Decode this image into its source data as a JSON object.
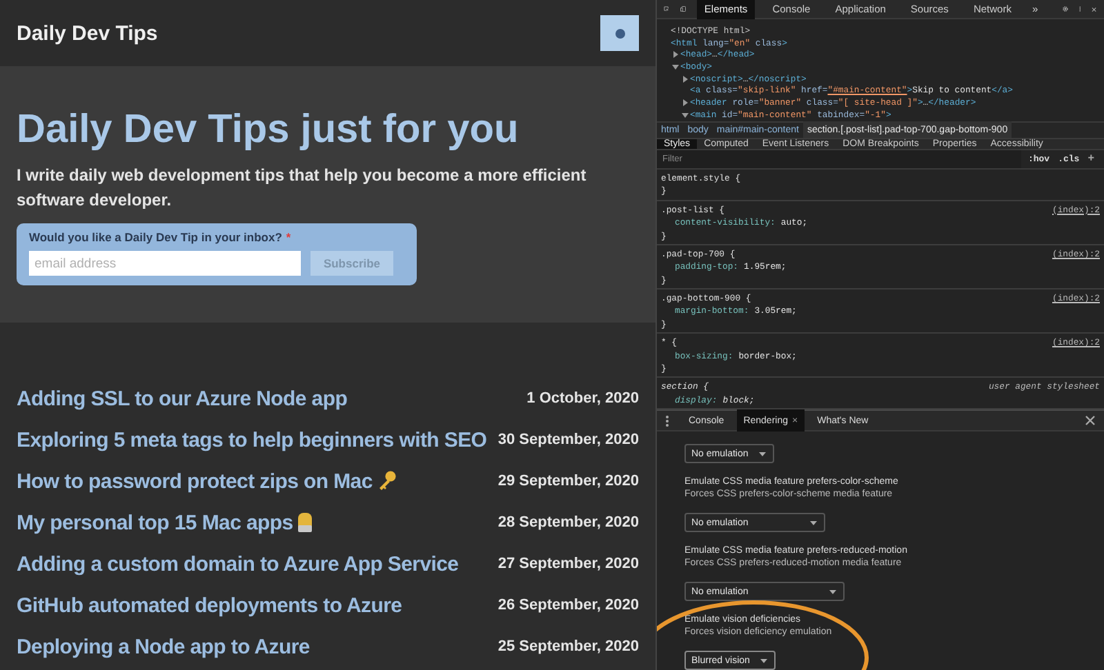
{
  "site": {
    "title": "Daily Dev Tips"
  },
  "hero": {
    "heading": "Daily Dev Tips just for you",
    "intro": "I write daily web development tips that help you become a more efficient software developer."
  },
  "subscribe": {
    "label": "Would you like a Daily Dev Tip in your inbox?",
    "required_mark": "*",
    "placeholder": "email address",
    "button": "Subscribe"
  },
  "posts": [
    {
      "title": "Adding SSL to our Azure Node app",
      "date": "1 October, 2020",
      "kind": "plain"
    },
    {
      "title": "Exploring 5 meta tags to help beginners with SEO",
      "date": "30 September, 2020",
      "kind": "plain"
    },
    {
      "title": "How to password protect zips on Mac",
      "date": "29 September, 2020",
      "kind": "key"
    },
    {
      "title": "My personal top 15 Mac apps",
      "date": "28 September, 2020",
      "kind": "emoji"
    },
    {
      "title": "Adding a custom domain to Azure App Service",
      "date": "27 September, 2020",
      "kind": "plain"
    },
    {
      "title": "GitHub automated deployments to Azure",
      "date": "26 September, 2020",
      "kind": "plain"
    },
    {
      "title": "Deploying a Node app to Azure",
      "date": "25 September, 2020",
      "kind": "plain"
    }
  ],
  "devtools": {
    "tabs": [
      {
        "label": "Elements",
        "selected": true
      },
      {
        "label": "Console",
        "selected": false
      },
      {
        "label": "Application",
        "selected": false
      },
      {
        "label": "Sources",
        "selected": false
      },
      {
        "label": "Network",
        "selected": false
      }
    ],
    "more_tabs": "»",
    "dom_tree": [
      {
        "parts": [
          {
            "kind": "doctype",
            "text": "<!DOCTYPE html>"
          }
        ]
      },
      {
        "parts": [
          {
            "kind": "tag",
            "text": "<html"
          },
          {
            "kind": "attr",
            "text": " lang="
          },
          {
            "kind": "val",
            "text": "\"en\""
          },
          {
            "kind": "attr",
            "text": " class"
          },
          {
            "kind": "tag",
            "text": ">"
          }
        ],
        "children": [
          {
            "parts": [
              {
                "kind": "tag",
                "text": "<head>"
              },
              {
                "kind": "text",
                "text": "…"
              },
              {
                "kind": "tag",
                "text": "</head>"
              }
            ],
            "expanded": false
          },
          {
            "parts": [
              {
                "kind": "tag",
                "text": "<body>"
              }
            ],
            "expanded": true,
            "children": [
              {
                "parts": [
                  {
                    "kind": "tag",
                    "text": "<noscript>"
                  },
                  {
                    "kind": "text",
                    "text": "…"
                  },
                  {
                    "kind": "tag",
                    "text": "</noscript>"
                  }
                ],
                "expanded": false
              },
              {
                "parts": [
                  {
                    "kind": "tag",
                    "text": "<a"
                  },
                  {
                    "kind": "attr",
                    "text": " class="
                  },
                  {
                    "kind": "val",
                    "text": "\"skip-link\""
                  },
                  {
                    "kind": "attr",
                    "text": " href="
                  },
                  {
                    "kind": "link",
                    "text": "\"#main-content\""
                  },
                  {
                    "kind": "tag",
                    "text": ">"
                  },
                  {
                    "kind": "text",
                    "text": "Skip to content"
                  },
                  {
                    "kind": "tag",
                    "text": "</a>"
                  }
                ]
              },
              {
                "parts": [
                  {
                    "kind": "tag",
                    "text": "<header"
                  },
                  {
                    "kind": "attr",
                    "text": " role="
                  },
                  {
                    "kind": "val",
                    "text": "\"banner\""
                  },
                  {
                    "kind": "attr",
                    "text": " class="
                  },
                  {
                    "kind": "val",
                    "text": "\"[ site-head ]\""
                  },
                  {
                    "kind": "tag",
                    "text": ">"
                  },
                  {
                    "kind": "text",
                    "text": "…"
                  },
                  {
                    "kind": "tag",
                    "text": "</header>"
                  }
                ],
                "expanded": false
              },
              {
                "parts": [
                  {
                    "kind": "tag",
                    "text": "<main"
                  },
                  {
                    "kind": "attr",
                    "text": " id="
                  },
                  {
                    "kind": "val",
                    "text": "\"main-content\""
                  },
                  {
                    "kind": "attr",
                    "text": " tabindex="
                  },
                  {
                    "kind": "val",
                    "text": "\"-1\""
                  },
                  {
                    "kind": "tag",
                    "text": ">"
                  }
                ],
                "expanded": true
              }
            ]
          }
        ]
      }
    ],
    "breadcrumbs": [
      {
        "label": "html",
        "selected": false
      },
      {
        "label": "body",
        "selected": false
      },
      {
        "label": "main#main-content",
        "selected": false
      },
      {
        "label": "section.[.post-list].pad-top-700.gap-bottom-900",
        "selected": true
      }
    ],
    "style_tabs": [
      {
        "label": "Styles",
        "selected": true
      },
      {
        "label": "Computed",
        "selected": false
      },
      {
        "label": "Event Listeners",
        "selected": false
      },
      {
        "label": "DOM Breakpoints",
        "selected": false
      },
      {
        "label": "Properties",
        "selected": false
      },
      {
        "label": "Accessibility",
        "selected": false
      }
    ],
    "filter": {
      "placeholder": "Filter",
      "hov": ":hov",
      "cls": ".cls",
      "add": "+"
    },
    "rules": [
      {
        "kind": "author",
        "selector": "element.style {",
        "close": "}"
      },
      {
        "kind": "author",
        "selector": ".post-list {",
        "source": "(index):2",
        "declarations": [
          {
            "property": "content-visibility:",
            "value": "auto;"
          }
        ],
        "close": "}"
      },
      {
        "kind": "author",
        "selector": ".pad-top-700 {",
        "source": "(index):2",
        "declarations": [
          {
            "property": "padding-top:",
            "value": "1.95rem;"
          }
        ],
        "close": "}"
      },
      {
        "kind": "author",
        "selector": ".gap-bottom-900 {",
        "source": "(index):2",
        "declarations": [
          {
            "property": "margin-bottom:",
            "value": "3.05rem;"
          }
        ],
        "close": "}"
      },
      {
        "kind": "author",
        "selector": "* {",
        "source": "(index):2",
        "declarations": [
          {
            "property": "box-sizing:",
            "value": "border-box;"
          }
        ],
        "close": "}"
      },
      {
        "kind": "user-agent",
        "selector": "section {",
        "source": "user agent stylesheet",
        "declarations": [
          {
            "property": "display:",
            "value": "block;"
          }
        ]
      }
    ],
    "drawer_tabs": [
      {
        "label": "Console",
        "selected": false,
        "closable": false
      },
      {
        "label": "Rendering",
        "selected": true,
        "closable": true
      },
      {
        "label": "What's New",
        "selected": false,
        "closable": false
      }
    ],
    "tab_close": "×",
    "rendering": {
      "top_select": "No emulation",
      "sections": [
        {
          "title": "Emulate CSS media feature prefers-color-scheme",
          "description": "Forces CSS prefers-color-scheme media feature",
          "select": "No emulation"
        },
        {
          "title": "Emulate CSS media feature prefers-reduced-motion",
          "description": "Forces CSS prefers-reduced-motion media feature",
          "select": "No emulation"
        },
        {
          "title": "Emulate vision deficiencies",
          "description": "Forces vision deficiency emulation",
          "select": "Blurred vision",
          "highlighted": true
        }
      ]
    }
  }
}
